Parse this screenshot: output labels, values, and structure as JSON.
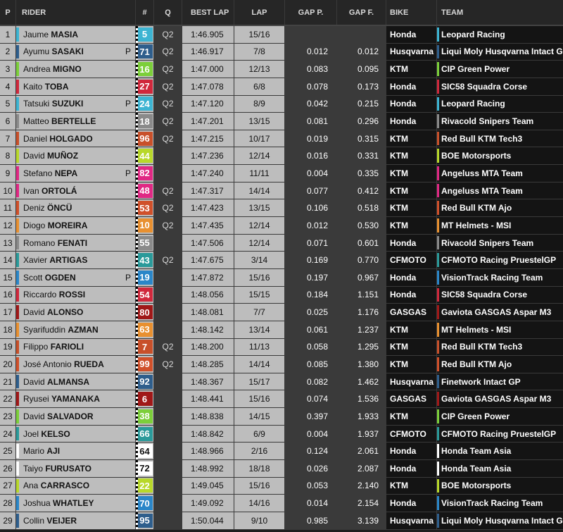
{
  "header": {
    "pos": "P",
    "rider": "RIDER",
    "num": "#",
    "q": "Q",
    "best_lap": "BEST LAP",
    "lap": "LAP",
    "gap_p": "GAP P.",
    "gap_f": "GAP F.",
    "bike": "BIKE",
    "team": "TEAM"
  },
  "rows": [
    {
      "pos": "1",
      "first": "Jaume",
      "last": "MASIA",
      "p": "",
      "num": "5",
      "num_color": "#3cb4d2",
      "q": "Q2",
      "best": "1:46.905",
      "lap": "15/16",
      "gap_p": "",
      "gap_f": "",
      "bike": "Honda",
      "team": "Leopard Racing",
      "team_color": "#3cb4d2"
    },
    {
      "pos": "2",
      "first": "Ayumu",
      "last": "SASAKI",
      "p": "P",
      "num": "71",
      "num_color": "#2e5e8c",
      "q": "Q2",
      "best": "1:46.917",
      "lap": "7/8",
      "gap_p": "0.012",
      "gap_f": "0.012",
      "bike": "Husqvarna",
      "team": "Liqui Moly Husqvarna Intact GP",
      "team_color": "#2e5e8c"
    },
    {
      "pos": "3",
      "first": "Andrea",
      "last": "MIGNO",
      "p": "",
      "num": "16",
      "num_color": "#7ccf3a",
      "q": "Q2",
      "best": "1:47.000",
      "lap": "12/13",
      "gap_p": "0.083",
      "gap_f": "0.095",
      "bike": "KTM",
      "team": "CIP Green Power",
      "team_color": "#7ccf3a"
    },
    {
      "pos": "4",
      "first": "Kaito",
      "last": "TOBA",
      "p": "",
      "num": "27",
      "num_color": "#d0283c",
      "q": "Q2",
      "best": "1:47.078",
      "lap": "6/8",
      "gap_p": "0.078",
      "gap_f": "0.173",
      "bike": "Honda",
      "team": "SIC58 Squadra Corse",
      "team_color": "#d0283c"
    },
    {
      "pos": "5",
      "first": "Tatsuki",
      "last": "SUZUKI",
      "p": "P",
      "num": "24",
      "num_color": "#3cb4d2",
      "q": "Q2",
      "best": "1:47.120",
      "lap": "8/9",
      "gap_p": "0.042",
      "gap_f": "0.215",
      "bike": "Honda",
      "team": "Leopard Racing",
      "team_color": "#3cb4d2"
    },
    {
      "pos": "6",
      "first": "Matteo",
      "last": "BERTELLE",
      "p": "",
      "num": "18",
      "num_color": "#8a8a8a",
      "q": "Q2",
      "best": "1:47.201",
      "lap": "13/15",
      "gap_p": "0.081",
      "gap_f": "0.296",
      "bike": "Honda",
      "team": "Rivacold Snipers Team",
      "team_color": "#8a8a8a"
    },
    {
      "pos": "7",
      "first": "Daniel",
      "last": "HOLGADO",
      "p": "",
      "num": "96",
      "num_color": "#c8502a",
      "q": "Q2",
      "best": "1:47.215",
      "lap": "10/17",
      "gap_p": "0.019",
      "gap_f": "0.315",
      "bike": "KTM",
      "team": "Red Bull KTM Tech3",
      "team_color": "#c8502a"
    },
    {
      "pos": "8",
      "first": "David",
      "last": "MUÑOZ",
      "p": "",
      "num": "44",
      "num_color": "#b8d82a",
      "q": "",
      "best": "1:47.236",
      "lap": "12/14",
      "gap_p": "0.016",
      "gap_f": "0.331",
      "bike": "KTM",
      "team": "BOE Motorsports",
      "team_color": "#b8d82a"
    },
    {
      "pos": "9",
      "first": "Stefano",
      "last": "NEPA",
      "p": "P",
      "num": "82",
      "num_color": "#e02884",
      "q": "",
      "best": "1:47.240",
      "lap": "11/11",
      "gap_p": "0.004",
      "gap_f": "0.335",
      "bike": "KTM",
      "team": "Angeluss MTA Team",
      "team_color": "#e02884"
    },
    {
      "pos": "10",
      "first": "Ivan",
      "last": "ORTOLÁ",
      "p": "",
      "num": "48",
      "num_color": "#e02884",
      "q": "Q2",
      "best": "1:47.317",
      "lap": "14/14",
      "gap_p": "0.077",
      "gap_f": "0.412",
      "bike": "KTM",
      "team": "Angeluss MTA Team",
      "team_color": "#e02884"
    },
    {
      "pos": "11",
      "first": "Deniz",
      "last": "ÖNCÜ",
      "p": "",
      "num": "53",
      "num_color": "#d0502a",
      "q": "Q2",
      "best": "1:47.423",
      "lap": "13/15",
      "gap_p": "0.106",
      "gap_f": "0.518",
      "bike": "KTM",
      "team": "Red Bull KTM Ajo",
      "team_color": "#d0502a"
    },
    {
      "pos": "12",
      "first": "Diogo",
      "last": "MOREIRA",
      "p": "",
      "num": "10",
      "num_color": "#e89030",
      "q": "Q2",
      "best": "1:47.435",
      "lap": "12/14",
      "gap_p": "0.012",
      "gap_f": "0.530",
      "bike": "KTM",
      "team": "MT Helmets - MSI",
      "team_color": "#e89030"
    },
    {
      "pos": "13",
      "first": "Romano",
      "last": "FENATI",
      "p": "",
      "num": "55",
      "num_color": "#8a8a8a",
      "q": "",
      "best": "1:47.506",
      "lap": "12/14",
      "gap_p": "0.071",
      "gap_f": "0.601",
      "bike": "Honda",
      "team": "Rivacold Snipers Team",
      "team_color": "#8a8a8a"
    },
    {
      "pos": "14",
      "first": "Xavier",
      "last": "ARTIGAS",
      "p": "",
      "num": "43",
      "num_color": "#2a9a9a",
      "q": "Q2",
      "best": "1:47.675",
      "lap": "3/14",
      "gap_p": "0.169",
      "gap_f": "0.770",
      "bike": "CFMOTO",
      "team": "CFMOTO Racing PruestelGP",
      "team_color": "#2a9a9a"
    },
    {
      "pos": "15",
      "first": "Scott",
      "last": "OGDEN",
      "p": "P",
      "num": "19",
      "num_color": "#2a86c8",
      "q": "",
      "best": "1:47.872",
      "lap": "15/16",
      "gap_p": "0.197",
      "gap_f": "0.967",
      "bike": "Honda",
      "team": "VisionTrack Racing Team",
      "team_color": "#2a86c8"
    },
    {
      "pos": "16",
      "first": "Riccardo",
      "last": "ROSSI",
      "p": "",
      "num": "54",
      "num_color": "#d0283c",
      "q": "",
      "best": "1:48.056",
      "lap": "15/15",
      "gap_p": "0.184",
      "gap_f": "1.151",
      "bike": "Honda",
      "team": "SIC58 Squadra Corse",
      "team_color": "#d0283c"
    },
    {
      "pos": "17",
      "first": "David",
      "last": "ALONSO",
      "p": "",
      "num": "80",
      "num_color": "#a01818",
      "q": "",
      "best": "1:48.081",
      "lap": "7/7",
      "gap_p": "0.025",
      "gap_f": "1.176",
      "bike": "GASGAS",
      "team": "Gaviota GASGAS Aspar M3",
      "team_color": "#a01818"
    },
    {
      "pos": "18",
      "first": "Syarifuddin",
      "last": "AZMAN",
      "p": "",
      "num": "63",
      "num_color": "#e89030",
      "q": "",
      "best": "1:48.142",
      "lap": "13/14",
      "gap_p": "0.061",
      "gap_f": "1.237",
      "bike": "KTM",
      "team": "MT Helmets - MSI",
      "team_color": "#e89030"
    },
    {
      "pos": "19",
      "first": "Filippo",
      "last": "FARIOLI",
      "p": "",
      "num": "7",
      "num_color": "#c8502a",
      "q": "Q2",
      "best": "1:48.200",
      "lap": "11/13",
      "gap_p": "0.058",
      "gap_f": "1.295",
      "bike": "KTM",
      "team": "Red Bull KTM Tech3",
      "team_color": "#c8502a"
    },
    {
      "pos": "20",
      "first": "José Antonio",
      "last": "RUEDA",
      "p": "",
      "num": "99",
      "num_color": "#d0502a",
      "q": "Q2",
      "best": "1:48.285",
      "lap": "14/14",
      "gap_p": "0.085",
      "gap_f": "1.380",
      "bike": "KTM",
      "team": "Red Bull KTM Ajo",
      "team_color": "#d0502a"
    },
    {
      "pos": "21",
      "first": "David",
      "last": "ALMANSA",
      "p": "",
      "num": "92",
      "num_color": "#2e5e8c",
      "q": "",
      "best": "1:48.367",
      "lap": "15/17",
      "gap_p": "0.082",
      "gap_f": "1.462",
      "bike": "Husqvarna",
      "team": "Finetwork Intact GP",
      "team_color": "#2e5e8c"
    },
    {
      "pos": "22",
      "first": "Ryusei",
      "last": "YAMANAKA",
      "p": "",
      "num": "6",
      "num_color": "#a01818",
      "q": "",
      "best": "1:48.441",
      "lap": "15/16",
      "gap_p": "0.074",
      "gap_f": "1.536",
      "bike": "GASGAS",
      "team": "Gaviota GASGAS Aspar M3",
      "team_color": "#a01818"
    },
    {
      "pos": "23",
      "first": "David",
      "last": "SALVADOR",
      "p": "",
      "num": "38",
      "num_color": "#7ccf3a",
      "q": "",
      "best": "1:48.838",
      "lap": "14/15",
      "gap_p": "0.397",
      "gap_f": "1.933",
      "bike": "KTM",
      "team": "CIP Green Power",
      "team_color": "#7ccf3a"
    },
    {
      "pos": "24",
      "first": "Joel",
      "last": "KELSO",
      "p": "",
      "num": "66",
      "num_color": "#2a9a9a",
      "q": "",
      "best": "1:48.842",
      "lap": "6/9",
      "gap_p": "0.004",
      "gap_f": "1.937",
      "bike": "CFMOTO",
      "team": "CFMOTO Racing PruestelGP",
      "team_color": "#2a9a9a"
    },
    {
      "pos": "25",
      "first": "Mario",
      "last": "AJI",
      "p": "",
      "num": "64",
      "num_color": "#ffffff",
      "q": "",
      "best": "1:48.966",
      "lap": "2/16",
      "gap_p": "0.124",
      "gap_f": "2.061",
      "bike": "Honda",
      "team": "Honda Team Asia",
      "team_color": "#ffffff"
    },
    {
      "pos": "26",
      "first": "Taiyo",
      "last": "FURUSATO",
      "p": "",
      "num": "72",
      "num_color": "#ffffff",
      "q": "",
      "best": "1:48.992",
      "lap": "18/18",
      "gap_p": "0.026",
      "gap_f": "2.087",
      "bike": "Honda",
      "team": "Honda Team Asia",
      "team_color": "#ffffff"
    },
    {
      "pos": "27",
      "first": "Ana",
      "last": "CARRASCO",
      "p": "",
      "num": "22",
      "num_color": "#b8d82a",
      "q": "",
      "best": "1:49.045",
      "lap": "15/16",
      "gap_p": "0.053",
      "gap_f": "2.140",
      "bike": "KTM",
      "team": "BOE Motorsports",
      "team_color": "#b8d82a"
    },
    {
      "pos": "28",
      "first": "Joshua",
      "last": "WHATLEY",
      "p": "",
      "num": "70",
      "num_color": "#2a86c8",
      "q": "",
      "best": "1:49.092",
      "lap": "14/16",
      "gap_p": "0.014",
      "gap_f": "2.154",
      "bike": "Honda",
      "team": "VisionTrack Racing Team",
      "team_color": "#2a86c8"
    },
    {
      "pos": "29",
      "first": "Collin",
      "last": "VEIJER",
      "p": "",
      "num": "95",
      "num_color": "#2e5e8c",
      "q": "",
      "best": "1:50.044",
      "lap": "9/10",
      "gap_p": "0.985",
      "gap_f": "3.139",
      "bike": "Husqvarna",
      "team": "Liqui Moly Husqvarna Intact GP",
      "team_color": "#2e5e8c"
    }
  ]
}
